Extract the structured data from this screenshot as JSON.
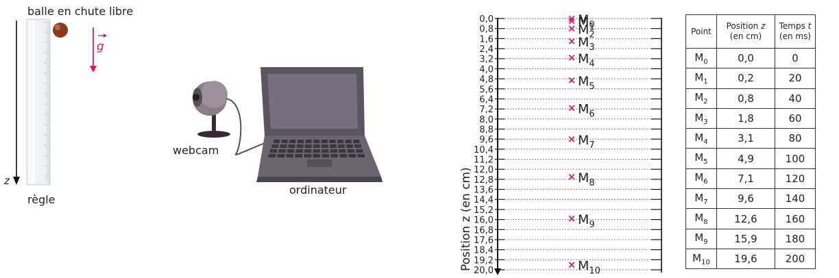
{
  "setup": {
    "caption_ball": "balle en chute libre",
    "caption_ruler": "règle",
    "axis_label": "z",
    "vector_label": "g",
    "caption_webcam": "webcam",
    "caption_computer": "ordinateur"
  },
  "chronophoto": {
    "axis_title": "Position z (en cm)",
    "tick_labels": [
      "0,0",
      "0,8",
      "1,6",
      "2,4",
      "3,2",
      "4,0",
      "4,8",
      "5,6",
      "6,4",
      "7,2",
      "8,0",
      "8,8",
      "9,6",
      "10,4",
      "11,2",
      "12,0",
      "12,8",
      "13,6",
      "14,4",
      "15,2",
      "16,0",
      "16,8",
      "17,6",
      "18,4",
      "19,2",
      "20,0"
    ],
    "marker_symbol": "×",
    "points": [
      {
        "label": "M",
        "sub": "0",
        "z": 0.0
      },
      {
        "label": "M",
        "sub": "1",
        "z": 0.2
      },
      {
        "label": "M",
        "sub": "2",
        "z": 0.8
      },
      {
        "label": "M",
        "sub": "3",
        "z": 1.8
      },
      {
        "label": "M",
        "sub": "4",
        "z": 3.1
      },
      {
        "label": "M",
        "sub": "5",
        "z": 4.9
      },
      {
        "label": "M",
        "sub": "6",
        "z": 7.1
      },
      {
        "label": "M",
        "sub": "7",
        "z": 9.6
      },
      {
        "label": "M",
        "sub": "8",
        "z": 12.6
      },
      {
        "label": "M",
        "sub": "9",
        "z": 15.9
      },
      {
        "label": "M",
        "sub": "10",
        "z": 19.6
      }
    ],
    "range": [
      0,
      20
    ],
    "marker_color": "#d81b60"
  },
  "table": {
    "headers": {
      "point": "Point",
      "position_l1a": "Position ",
      "position_var": "z",
      "position_l2": "(en cm)",
      "temps_l1a": "Temps ",
      "temps_var": "t",
      "temps_l2": "(en ms)"
    },
    "rows": [
      {
        "point": "M",
        "sub": "0",
        "z": "0,0",
        "t": "0"
      },
      {
        "point": "M",
        "sub": "1",
        "z": "0,2",
        "t": "20"
      },
      {
        "point": "M",
        "sub": "2",
        "z": "0,8",
        "t": "40"
      },
      {
        "point": "M",
        "sub": "3",
        "z": "1,8",
        "t": "60"
      },
      {
        "point": "M",
        "sub": "4",
        "z": "3,1",
        "t": "80"
      },
      {
        "point": "M",
        "sub": "5",
        "z": "4,9",
        "t": "100"
      },
      {
        "point": "M",
        "sub": "6",
        "z": "7,1",
        "t": "120"
      },
      {
        "point": "M",
        "sub": "7",
        "z": "9,6",
        "t": "140"
      },
      {
        "point": "M",
        "sub": "8",
        "z": "12,6",
        "t": "160"
      },
      {
        "point": "M",
        "sub": "9",
        "z": "15,9",
        "t": "180"
      },
      {
        "point": "M",
        "sub": "10",
        "z": "19,6",
        "t": "200"
      }
    ]
  },
  "colors": {
    "accent": "#d81b60",
    "ball": "#8b3a1a",
    "laptop": "#5a5560",
    "screen": "#7a6f80",
    "webcam": "#8b7d8a"
  }
}
